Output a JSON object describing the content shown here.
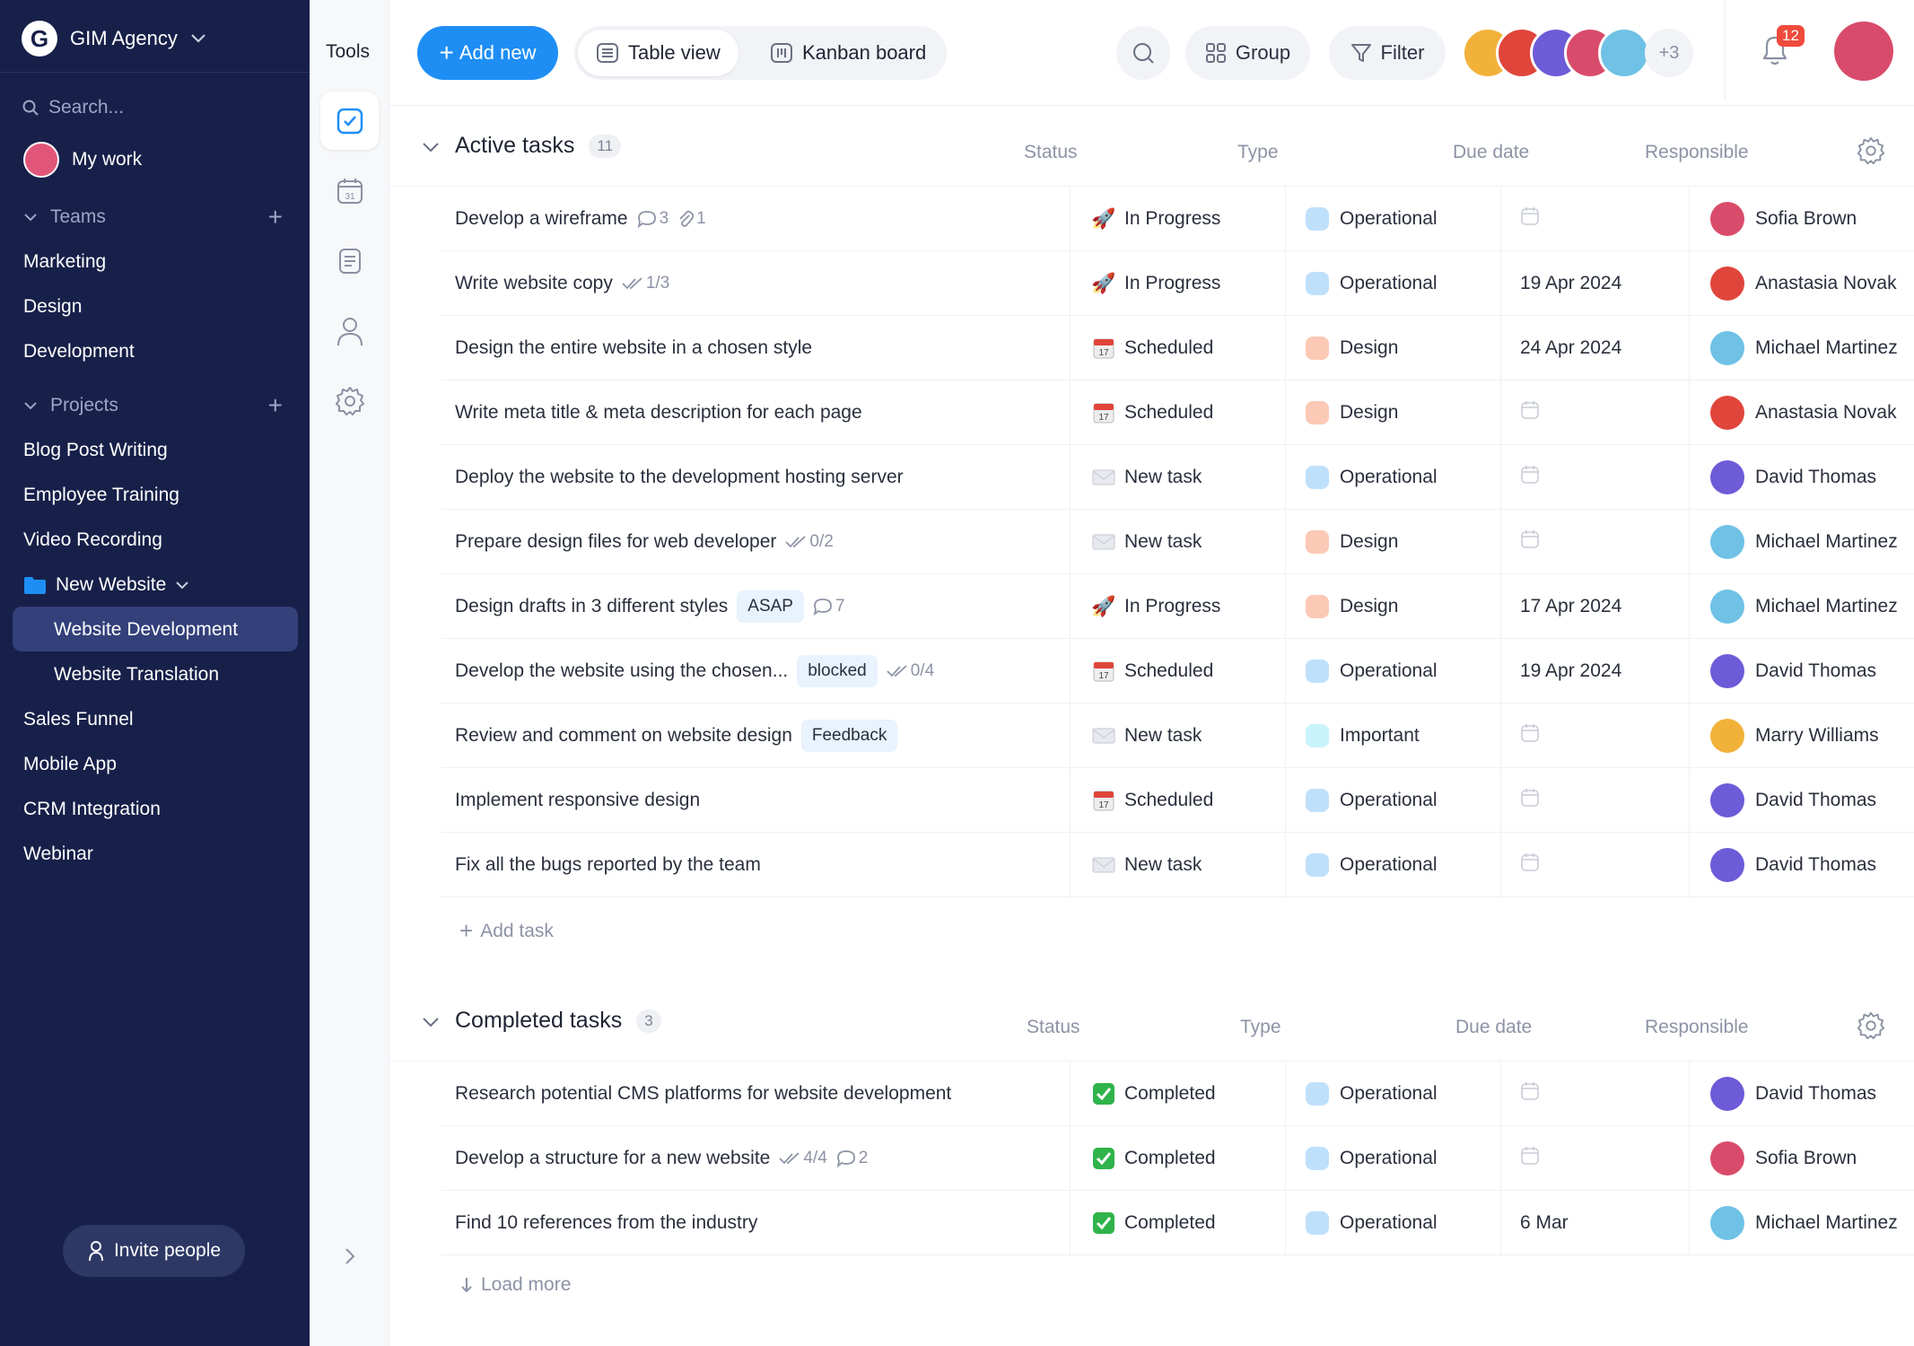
{
  "workspace": {
    "name": "GIM Agency",
    "logo_letter": "G"
  },
  "sidebar": {
    "search_placeholder": "Search...",
    "my_work": "My work",
    "teams_label": "Teams",
    "teams": [
      "Marketing",
      "Design",
      "Development"
    ],
    "projects_label": "Projects",
    "projects": [
      "Blog Post Writing",
      "Employee Training",
      "Video Recording"
    ],
    "folder": "New Website",
    "folder_items": [
      "Website Development",
      "Website Translation"
    ],
    "projects_after": [
      "Sales Funnel",
      "Mobile App",
      "CRM Integration",
      "Webinar"
    ],
    "invite": "Invite people"
  },
  "tools": {
    "label": "Tools"
  },
  "toolbar": {
    "add_new": "Add new",
    "table_view": "Table view",
    "kanban": "Kanban board",
    "group": "Group",
    "filter": "Filter",
    "more_members": "+3",
    "notifications": "12"
  },
  "colors": {
    "accent": "#1e8ef5",
    "sidebar_bg": "#172049",
    "operational": "#bfe0fb",
    "design": "#fbc9b5",
    "important": "#c9f3fb"
  },
  "columns": {
    "status": "Status",
    "type": "Type",
    "due": "Due date",
    "responsible": "Responsible"
  },
  "active": {
    "title": "Active tasks",
    "count": "11",
    "add_task": "Add task",
    "rows": [
      {
        "name": "Develop a wireframe",
        "tag": "",
        "meta": [
          {
            "icon": "comment",
            "text": "3"
          },
          {
            "icon": "clip",
            "text": "1"
          }
        ],
        "status": "In Progress",
        "status_icon": "rocket",
        "type": "Operational",
        "type_color": "#bfe0fb",
        "due": "",
        "resp": "Sofia Brown",
        "resp_color": "#d94b6a"
      },
      {
        "name": "Write website copy",
        "tag": "",
        "meta": [
          {
            "icon": "check",
            "text": "1/3"
          }
        ],
        "status": "In Progress",
        "status_icon": "rocket",
        "type": "Operational",
        "type_color": "#bfe0fb",
        "due": "19 Apr 2024",
        "resp": "Anastasia Novak",
        "resp_color": "#e0453b"
      },
      {
        "name": "Design the entire website in a chosen style",
        "tag": "",
        "meta": [],
        "status": "Scheduled",
        "status_icon": "calendar",
        "type": "Design",
        "type_color": "#fbc9b5",
        "due": "24 Apr 2024",
        "resp": "Michael Martinez",
        "resp_color": "#6fc1e6"
      },
      {
        "name": "Write meta title & meta description for each page",
        "tag": "",
        "meta": [],
        "status": "Scheduled",
        "status_icon": "calendar",
        "type": "Design",
        "type_color": "#fbc9b5",
        "due": "",
        "resp": "Anastasia Novak",
        "resp_color": "#e0453b"
      },
      {
        "name": "Deploy the website to the development hosting server",
        "tag": "",
        "meta": [],
        "status": "New task",
        "status_icon": "envelope",
        "type": "Operational",
        "type_color": "#bfe0fb",
        "due": "",
        "resp": "David Thomas",
        "resp_color": "#6d5bd8"
      },
      {
        "name": "Prepare design files for web developer",
        "tag": "",
        "meta": [
          {
            "icon": "check",
            "text": "0/2"
          }
        ],
        "status": "New task",
        "status_icon": "envelope",
        "type": "Design",
        "type_color": "#fbc9b5",
        "due": "",
        "resp": "Michael Martinez",
        "resp_color": "#6fc1e6"
      },
      {
        "name": "Design drafts in 3 different styles",
        "tag": "ASAP",
        "meta": [
          {
            "icon": "comment",
            "text": "7"
          }
        ],
        "status": "In Progress",
        "status_icon": "rocket",
        "type": "Design",
        "type_color": "#fbc9b5",
        "due": "17 Apr 2024",
        "resp": "Michael Martinez",
        "resp_color": "#6fc1e6"
      },
      {
        "name": "Develop the website using the chosen...",
        "tag": "blocked",
        "meta": [
          {
            "icon": "check",
            "text": "0/4"
          }
        ],
        "status": "Scheduled",
        "status_icon": "calendar",
        "type": "Operational",
        "type_color": "#bfe0fb",
        "due": "19 Apr 2024",
        "resp": "David Thomas",
        "resp_color": "#6d5bd8"
      },
      {
        "name": "Review and comment on website design",
        "tag": "Feedback",
        "meta": [],
        "status": "New task",
        "status_icon": "envelope",
        "type": "Important",
        "type_color": "#c9f3fb",
        "due": "",
        "resp": "Marry Williams",
        "resp_color": "#f2b23a"
      },
      {
        "name": "Implement responsive design",
        "tag": "",
        "meta": [],
        "status": "Scheduled",
        "status_icon": "calendar",
        "type": "Operational",
        "type_color": "#bfe0fb",
        "due": "",
        "resp": "David Thomas",
        "resp_color": "#6d5bd8"
      },
      {
        "name": "Fix all the bugs reported by the team",
        "tag": "",
        "meta": [],
        "status": "New task",
        "status_icon": "envelope",
        "type": "Operational",
        "type_color": "#bfe0fb",
        "due": "",
        "resp": "David Thomas",
        "resp_color": "#6d5bd8"
      }
    ]
  },
  "completed": {
    "title": "Completed tasks",
    "count": "3",
    "load_more": "Load more",
    "rows": [
      {
        "name": "Research potential CMS platforms for website development",
        "tag": "",
        "meta": [],
        "status": "Completed",
        "status_icon": "done",
        "type": "Operational",
        "type_color": "#bfe0fb",
        "due": "",
        "resp": "David Thomas",
        "resp_color": "#6d5bd8"
      },
      {
        "name": "Develop a structure for a new website",
        "tag": "",
        "meta": [
          {
            "icon": "check",
            "text": "4/4"
          },
          {
            "icon": "comment",
            "text": "2"
          }
        ],
        "status": "Completed",
        "status_icon": "done",
        "type": "Operational",
        "type_color": "#bfe0fb",
        "due": "",
        "resp": "Sofia Brown",
        "resp_color": "#d94b6a"
      },
      {
        "name": "Find 10 references from the industry",
        "tag": "",
        "meta": [],
        "status": "Completed",
        "status_icon": "done",
        "type": "Operational",
        "type_color": "#bfe0fb",
        "due": "6 Mar",
        "resp": "Michael Martinez",
        "resp_color": "#6fc1e6"
      }
    ]
  }
}
